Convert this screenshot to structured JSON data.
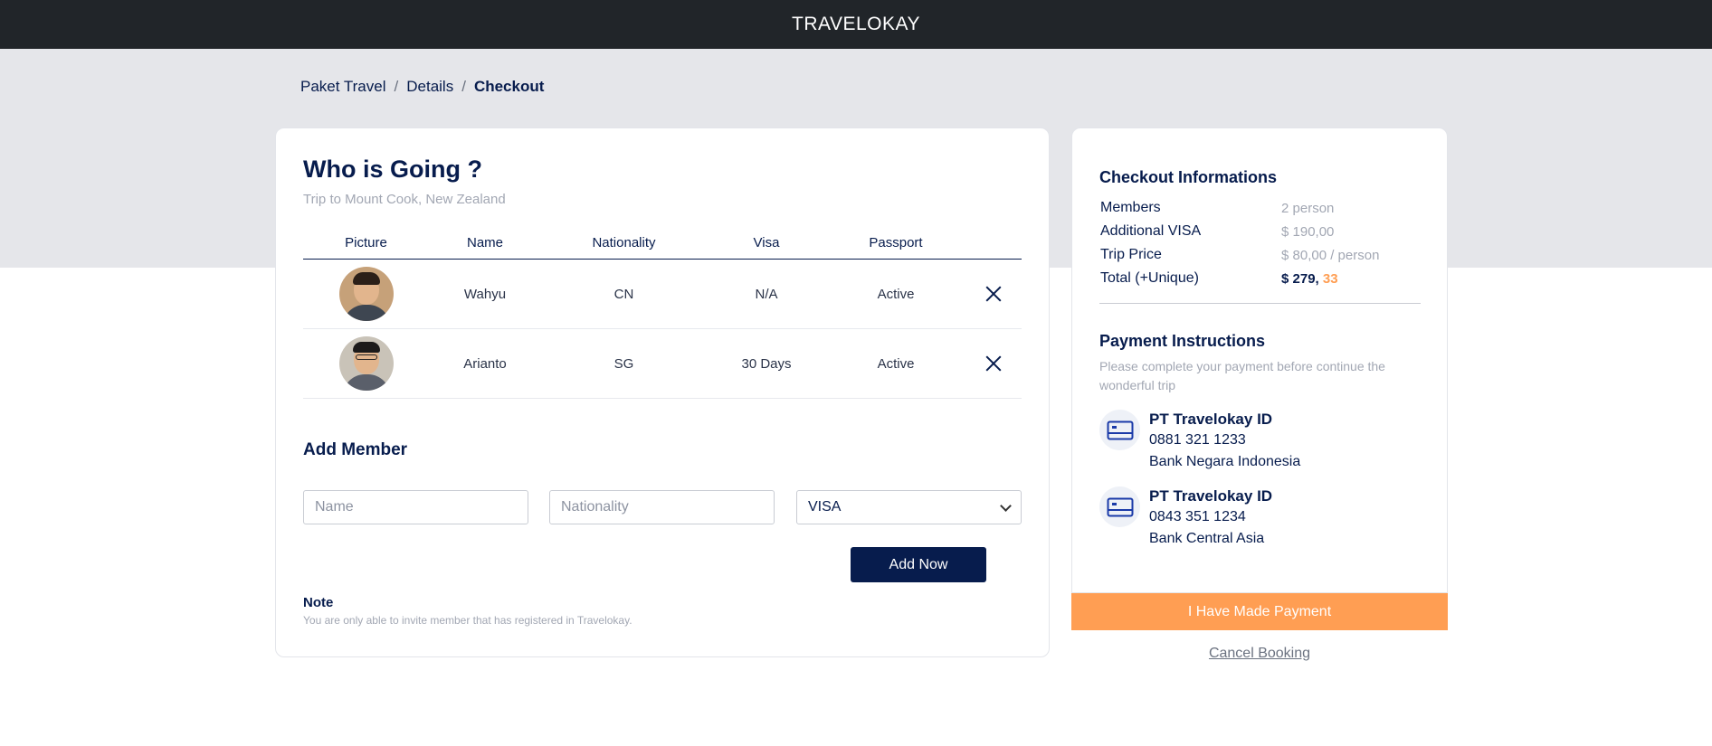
{
  "header": {
    "brand": "TRAVELOKAY"
  },
  "breadcrumb": {
    "items": [
      "Paket Travel",
      "Details",
      "Checkout"
    ]
  },
  "main": {
    "title": "Who is Going ?",
    "subtitle": "Trip to Mount Cook, New Zealand",
    "table": {
      "headers": [
        "Picture",
        "Name",
        "Nationality",
        "Visa",
        "Passport"
      ],
      "rows": [
        {
          "name": "Wahyu",
          "nationality": "CN",
          "visa": "N/A",
          "passport": "Active"
        },
        {
          "name": "Arianto",
          "nationality": "SG",
          "visa": "30 Days",
          "passport": "Active"
        }
      ]
    },
    "add_member": {
      "title": "Add Member",
      "name_placeholder": "Name",
      "nationality_placeholder": "Nationality",
      "visa_selected": "VISA",
      "button": "Add Now"
    },
    "note": {
      "title": "Note",
      "text": "You are only able to invite member that has registered in Travelokay."
    }
  },
  "side": {
    "checkout_title": "Checkout Informations",
    "info": [
      {
        "label": "Members",
        "value": "2 person"
      },
      {
        "label": "Additional VISA",
        "value": "$ 190,00"
      },
      {
        "label": "Trip Price",
        "value": "$ 80,00 / person"
      },
      {
        "label": "Total (+Unique)",
        "value_main": "$ 279,",
        "value_cents": "33"
      }
    ],
    "payment_title": "Payment Instructions",
    "payment_desc": "Please complete your payment before continue the wonderful trip",
    "banks": [
      {
        "name": "PT Travelokay ID",
        "account": "0881 321 1233",
        "bank": "Bank Negara Indonesia"
      },
      {
        "name": "PT Travelokay ID",
        "account": "0843 351 1234",
        "bank": "Bank Central Asia"
      }
    ],
    "paid_button": "I Have Made Payment",
    "cancel_link": "Cancel Booking"
  },
  "colors": {
    "navy": "#071c4d",
    "orange": "#ff9e53",
    "topbar": "#212529",
    "hero": "#e5e6ea"
  }
}
